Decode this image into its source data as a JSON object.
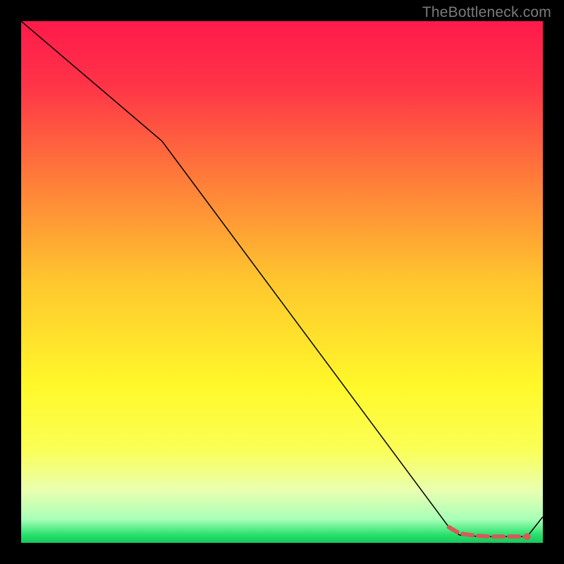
{
  "watermark": "TheBottleneck.com",
  "chart_data": {
    "type": "line",
    "title": "",
    "xlabel": "",
    "ylabel": "",
    "xlim": [
      0,
      100
    ],
    "ylim": [
      0,
      100
    ],
    "grid": false,
    "series": [
      {
        "name": "curve",
        "color": "#000000",
        "stroke_width": 1.5,
        "x": [
          0,
          27,
          82,
          84,
          88,
          90,
          93,
          94,
          97,
          100
        ],
        "values": [
          100,
          77,
          3,
          1.5,
          1.2,
          1.2,
          1.2,
          1.2,
          1.2,
          5
        ]
      }
    ],
    "highlight": {
      "comment": "short dashed red segment near the valley floor",
      "color": "#d65a5a",
      "stroke_width": 6,
      "dash": "14 8",
      "points_x": [
        82,
        84,
        86,
        88,
        90,
        92,
        94,
        96,
        97
      ],
      "points_y": [
        3.0,
        1.8,
        1.5,
        1.3,
        1.2,
        1.2,
        1.2,
        1.2,
        1.2
      ],
      "end_dot": {
        "x": 97,
        "y": 1.2,
        "r": 5
      }
    },
    "background_gradient": {
      "stops": [
        {
          "offset": 0.0,
          "color": "#ff1a4b"
        },
        {
          "offset": 0.12,
          "color": "#ff3348"
        },
        {
          "offset": 0.3,
          "color": "#ff7b3a"
        },
        {
          "offset": 0.5,
          "color": "#ffc72e"
        },
        {
          "offset": 0.7,
          "color": "#fff82a"
        },
        {
          "offset": 0.82,
          "color": "#fbff55"
        },
        {
          "offset": 0.9,
          "color": "#e9ffb0"
        },
        {
          "offset": 0.955,
          "color": "#a8ffb8"
        },
        {
          "offset": 0.985,
          "color": "#27e06a"
        },
        {
          "offset": 1.0,
          "color": "#16c95c"
        }
      ]
    }
  }
}
